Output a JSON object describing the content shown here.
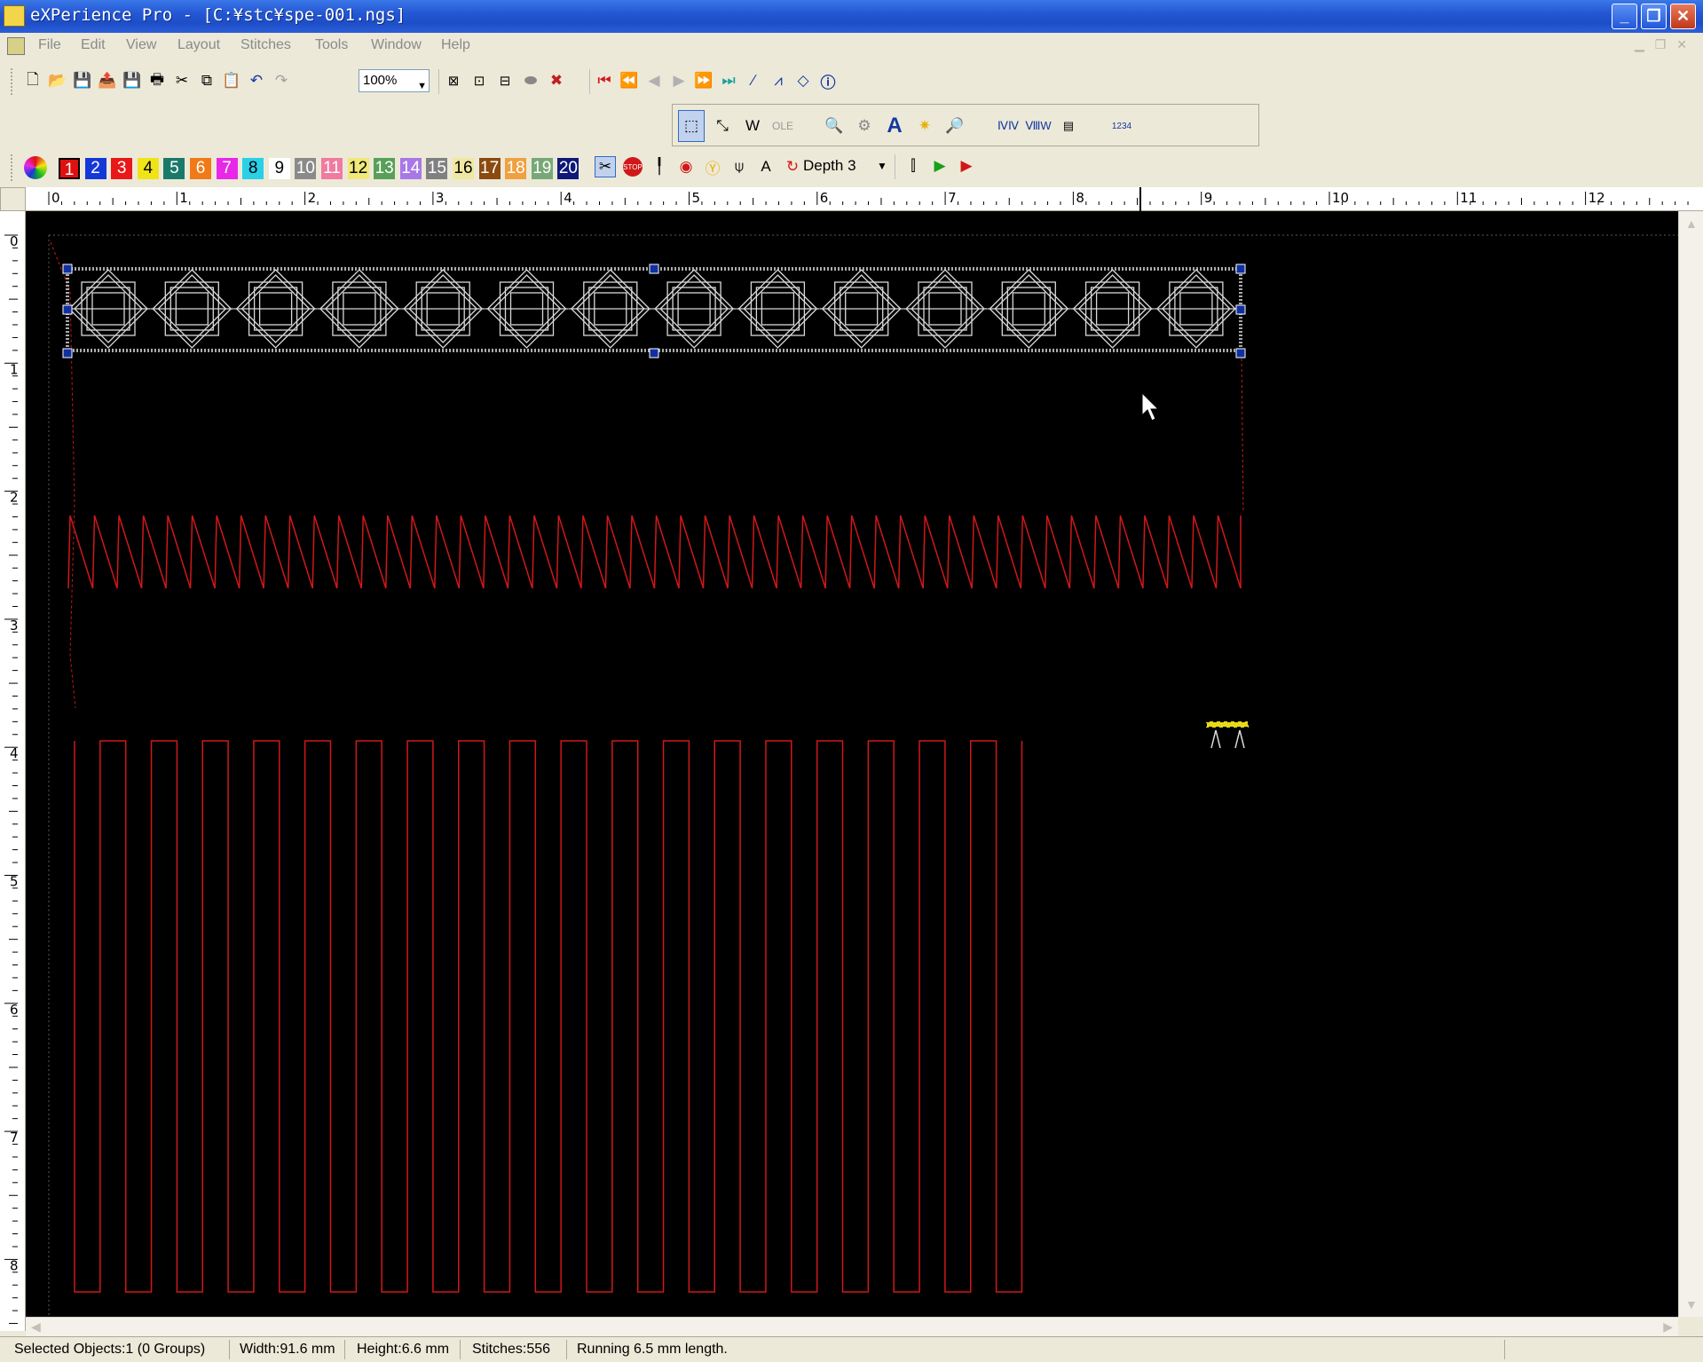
{
  "window": {
    "title": "eXPerience Pro - [C:¥stc¥spe-001.ngs]"
  },
  "menu": [
    "File",
    "Edit",
    "View",
    "Layout",
    "Stitches",
    "Tools",
    "Window",
    "Help"
  ],
  "toolbar": {
    "zoom_value": "100%",
    "depth_label": "Depth 3"
  },
  "colors": [
    {
      "n": "1",
      "bg": "#e01010",
      "fg": "#ffffff"
    },
    {
      "n": "2",
      "bg": "#1438d8",
      "fg": "#ffffff"
    },
    {
      "n": "3",
      "bg": "#e81818",
      "fg": "#ffffff"
    },
    {
      "n": "4",
      "bg": "#f0e418",
      "fg": "#000000"
    },
    {
      "n": "5",
      "bg": "#1a7a6a",
      "fg": "#ffffff"
    },
    {
      "n": "6",
      "bg": "#f07a18",
      "fg": "#ffffff"
    },
    {
      "n": "7",
      "bg": "#e828e8",
      "fg": "#ffffff"
    },
    {
      "n": "8",
      "bg": "#28d0e8",
      "fg": "#000000"
    },
    {
      "n": "9",
      "bg": "#ffffff",
      "fg": "#000000"
    },
    {
      "n": "10",
      "bg": "#8a8a8a",
      "fg": "#ffffff"
    },
    {
      "n": "11",
      "bg": "#f07aa0",
      "fg": "#ffffff"
    },
    {
      "n": "12",
      "bg": "#f0e878",
      "fg": "#000000"
    },
    {
      "n": "13",
      "bg": "#58a058",
      "fg": "#ffffff"
    },
    {
      "n": "14",
      "bg": "#a878e8",
      "fg": "#ffffff"
    },
    {
      "n": "15",
      "bg": "#808080",
      "fg": "#ffffff"
    },
    {
      "n": "16",
      "bg": "#f0e8a0",
      "fg": "#000000"
    },
    {
      "n": "17",
      "bg": "#8a4a10",
      "fg": "#ffffff"
    },
    {
      "n": "18",
      "bg": "#f0a040",
      "fg": "#ffffff"
    },
    {
      "n": "19",
      "bg": "#78a878",
      "fg": "#ffffff"
    },
    {
      "n": "20",
      "bg": "#101878",
      "fg": "#ffffff"
    }
  ],
  "ruler": {
    "h_labels": [
      "0",
      "1",
      "2",
      "3",
      "4",
      "5",
      "6",
      "7",
      "8",
      "9",
      "10",
      "11",
      "12"
    ],
    "v_labels": [
      "0",
      "1",
      "2",
      "3",
      "4",
      "5",
      "6",
      "7",
      "8"
    ]
  },
  "status": {
    "selected": "Selected Objects:1 (0 Groups)",
    "width": "Width:91.6 mm",
    "height": "Height:6.6 mm",
    "stitches": "Stitches:556",
    "running": "Running 6.5 mm length."
  }
}
